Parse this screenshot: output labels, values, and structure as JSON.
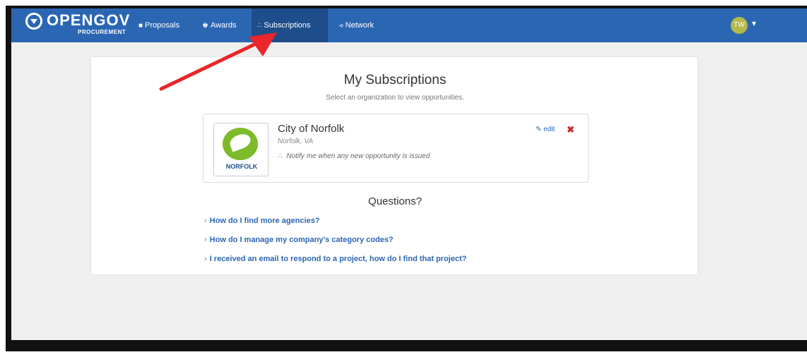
{
  "nav": {
    "brand": "OPENGOV",
    "brand_sub": "PROCUREMENT",
    "items": [
      {
        "label": "Proposals",
        "icon": "document-icon"
      },
      {
        "label": "Awards",
        "icon": "trophy-icon"
      },
      {
        "label": "Subscriptions",
        "icon": "rss-icon"
      },
      {
        "label": "Network",
        "icon": "share-icon"
      }
    ],
    "active": "Subscriptions",
    "avatar_initials": "TW",
    "avatar_color": "#b5b84a"
  },
  "page": {
    "title": "My Subscriptions",
    "subtitle": "Select an organization to view opportunities."
  },
  "subscription": {
    "org_logo_text": "NORFOLK",
    "org_name": "City of Norfolk",
    "location": "Norfolk, VA",
    "notify_text": "Notify me when any new opportunity is issued",
    "edit_label": "edit",
    "remove_icon": "close-icon"
  },
  "questions": {
    "title": "Questions?",
    "items": [
      "How do I find more agencies?",
      "How do I manage my company's category codes?",
      "I received an email to respond to a project, how do I find that project?"
    ]
  },
  "colors": {
    "navbar": "#2b66b3",
    "navbar_active": "#1e4d8c",
    "link": "#2b66b3",
    "annotation_arrow": "#e8262b"
  }
}
